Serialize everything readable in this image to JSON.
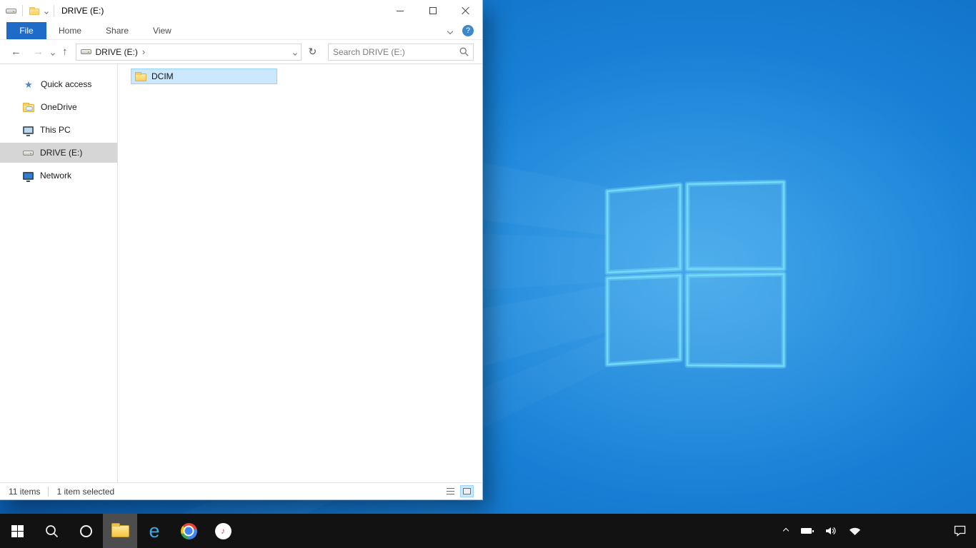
{
  "titlebar": {
    "title": "DRIVE (E:)"
  },
  "ribbon": {
    "file_tab": "File",
    "tabs": [
      "Home",
      "Share",
      "View"
    ]
  },
  "navbar": {
    "address_crumb": "DRIVE (E:)",
    "search_placeholder": "Search DRIVE (E:)"
  },
  "sidebar": {
    "items": [
      {
        "label": "Quick access"
      },
      {
        "label": "OneDrive"
      },
      {
        "label": "This PC"
      },
      {
        "label": "DRIVE (E:)",
        "selected": true
      },
      {
        "label": "Network"
      }
    ]
  },
  "files": {
    "items": [
      {
        "name": "DCIM",
        "selected": true
      }
    ]
  },
  "statusbar": {
    "count": "11 items",
    "selected": "1 item selected"
  },
  "glyphs": {
    "help": "?",
    "back": "←",
    "forward": "→",
    "up": "↑",
    "refresh": "↻",
    "breadcrumb_chevron": "›",
    "star": "★",
    "ie": "e",
    "itunes": "♪"
  },
  "colors": {
    "selection_fill": "#cce8ff",
    "selection_border": "#99d1ff",
    "file_tab_blue": "#1e6bc8",
    "desktop_blue": "#1478cf",
    "taskbar_black": "#121212"
  },
  "taskbar": {
    "icons": [
      "start",
      "search",
      "cortana",
      "file-explorer",
      "internet-explorer",
      "chrome",
      "itunes"
    ],
    "tray": [
      "hidden-icons-chevron",
      "battery",
      "volume",
      "network",
      "action-center"
    ]
  }
}
